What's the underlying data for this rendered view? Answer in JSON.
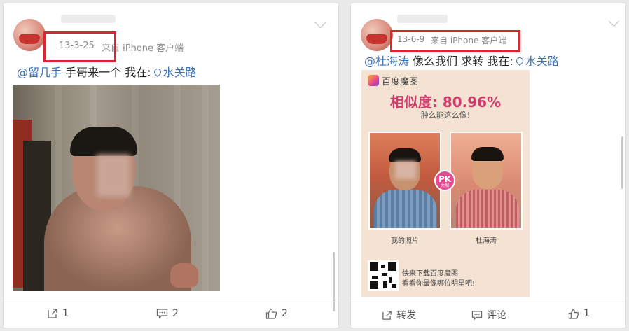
{
  "posts": [
    {
      "date": "13-3-25",
      "source": "来自 iPhone 客户端",
      "mention": "@留几手",
      "text": "手哥来一个 我在:",
      "location": "水关路",
      "actions": {
        "repost_count": "1",
        "comment_count": "2",
        "like_count": "2"
      }
    },
    {
      "date": "13-6-9",
      "source": "来自 iPhone 客户端",
      "mention": "@杜海涛",
      "text": "像么我们 求转 我在:",
      "location": "水关路",
      "image": {
        "brand": "百度魔图",
        "similarity": "相似度: 80.96%",
        "subtitle": "肿么能这么像!",
        "badge": "PK",
        "badge_sub": "大咖",
        "caption_left": "我的照片",
        "caption_right": "杜海涛",
        "promo_line1": "快来下载百度魔图",
        "promo_line2": "看看你最像哪位明星吧!"
      },
      "actions": {
        "repost_label": "转发",
        "comment_label": "评论",
        "like_count": "1"
      }
    }
  ],
  "colors": {
    "highlight_box": "#e0242f",
    "link": "#3b6fb6",
    "similarity": "#d23c6d"
  }
}
